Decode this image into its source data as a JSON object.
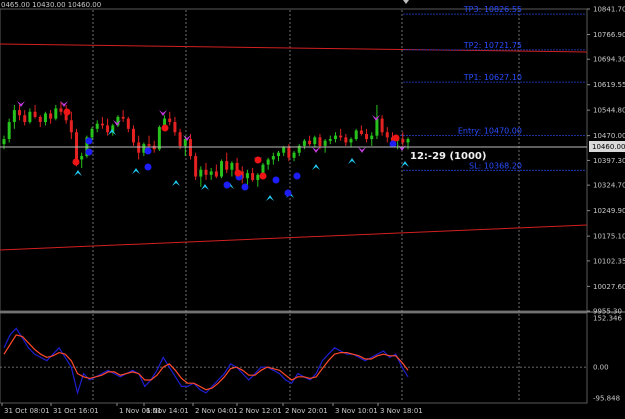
{
  "header": {
    "ohlc_text": "0465.00 10430.00 10460.00"
  },
  "levels": [
    {
      "key": "tp3",
      "label": "TP3: 10826.55",
      "value": 10826.55
    },
    {
      "key": "tp2",
      "label": "TP2: 10721.75",
      "value": 10721.75
    },
    {
      "key": "tp1",
      "label": "TP1: 10627.10",
      "value": 10627.1
    },
    {
      "key": "entry",
      "label": "Entry: 10470.00",
      "value": 10470.0
    },
    {
      "key": "sl",
      "label": "SL: 10368.20",
      "value": 10368.2
    }
  ],
  "trade_label": "12:-29 (1000)",
  "current_price": "10460.00",
  "price_axis": [
    "10841.70",
    "10766.90",
    "10694.30",
    "10619.55",
    "10544.80",
    "10470.00",
    "10397.30",
    "10324.70",
    "10249.90",
    "10175.10",
    "10102.35",
    "10027.60",
    "9955.30"
  ],
  "indicator_axis": [
    "152.346",
    "0.00",
    "-95.848"
  ],
  "time_axis": [
    "31 Oct 08:01",
    "31 Oct 16:01",
    "1 Nov 06:01",
    "1 Nov 14:01",
    "2 Nov 04:01",
    "2 Nov 12:01",
    "2 Nov 20:01",
    "3 Nov 10:01",
    "3 Nov 18:01"
  ],
  "colors": {
    "bull": "#27c21c",
    "bear": "#e52222",
    "grid": "#8a8a8a",
    "channel": "#d22020",
    "level": "#1f3fd0",
    "signal_blue": "#1d1df5",
    "signal_red": "#f01515",
    "arrow_purple": "#c53be0",
    "arrow_cyan": "#20c8f0",
    "osc_main": "#1f1fcf",
    "osc_signal": "#ff4a2a"
  },
  "chart_data": {
    "type": "candlestick",
    "price_range": [
      9955.3,
      10841.7
    ],
    "candles_ohlc": [
      [
        10445,
        10470,
        10430,
        10460
      ],
      [
        10460,
        10520,
        10450,
        10510
      ],
      [
        10510,
        10560,
        10490,
        10545
      ],
      [
        10545,
        10560,
        10515,
        10530
      ],
      [
        10530,
        10545,
        10500,
        10510
      ],
      [
        10510,
        10550,
        10505,
        10540
      ],
      [
        10540,
        10560,
        10520,
        10525
      ],
      [
        10525,
        10530,
        10495,
        10510
      ],
      [
        10510,
        10540,
        10500,
        10535
      ],
      [
        10535,
        10545,
        10505,
        10520
      ],
      [
        10520,
        10560,
        10515,
        10550
      ],
      [
        10550,
        10570,
        10530,
        10540
      ],
      [
        10540,
        10560,
        10505,
        10515
      ],
      [
        10515,
        10540,
        10460,
        10480
      ],
      [
        10480,
        10490,
        10380,
        10400
      ],
      [
        10400,
        10420,
        10375,
        10410
      ],
      [
        10410,
        10470,
        10405,
        10465
      ],
      [
        10465,
        10495,
        10455,
        10490
      ],
      [
        10490,
        10515,
        10480,
        10505
      ],
      [
        10505,
        10525,
        10490,
        10500
      ],
      [
        10500,
        10520,
        10470,
        10480
      ],
      [
        10480,
        10505,
        10470,
        10500
      ],
      [
        10500,
        10530,
        10495,
        10525
      ],
      [
        10525,
        10545,
        10510,
        10520
      ],
      [
        10520,
        10525,
        10480,
        10490
      ],
      [
        10490,
        10500,
        10440,
        10450
      ],
      [
        10450,
        10470,
        10400,
        10420
      ],
      [
        10420,
        10450,
        10410,
        10445
      ],
      [
        10445,
        10470,
        10435,
        10440
      ],
      [
        10440,
        10455,
        10420,
        10430
      ],
      [
        10430,
        10500,
        10425,
        10495
      ],
      [
        10495,
        10530,
        10485,
        10520
      ],
      [
        10520,
        10540,
        10500,
        10510
      ],
      [
        10510,
        10525,
        10470,
        10480
      ],
      [
        10480,
        10490,
        10430,
        10440
      ],
      [
        10440,
        10470,
        10410,
        10460
      ],
      [
        10460,
        10475,
        10400,
        10410
      ],
      [
        10410,
        10420,
        10340,
        10350
      ],
      [
        10350,
        10380,
        10320,
        10370
      ],
      [
        10370,
        10390,
        10340,
        10355
      ],
      [
        10355,
        10375,
        10340,
        10365
      ],
      [
        10365,
        10385,
        10345,
        10350
      ],
      [
        10350,
        10400,
        10345,
        10395
      ],
      [
        10395,
        10420,
        10360,
        10370
      ],
      [
        10370,
        10395,
        10350,
        10390
      ],
      [
        10390,
        10405,
        10360,
        10365
      ],
      [
        10365,
        10380,
        10330,
        10345
      ],
      [
        10345,
        10370,
        10325,
        10360
      ],
      [
        10360,
        10375,
        10335,
        10340
      ],
      [
        10340,
        10360,
        10320,
        10355
      ],
      [
        10355,
        10390,
        10350,
        10385
      ],
      [
        10385,
        10405,
        10370,
        10400
      ],
      [
        10400,
        10420,
        10385,
        10410
      ],
      [
        10410,
        10425,
        10395,
        10420
      ],
      [
        10420,
        10440,
        10410,
        10435
      ],
      [
        10435,
        10445,
        10395,
        10405
      ],
      [
        10405,
        10425,
        10395,
        10420
      ],
      [
        10420,
        10445,
        10410,
        10440
      ],
      [
        10440,
        10460,
        10430,
        10455
      ],
      [
        10455,
        10470,
        10440,
        10445
      ],
      [
        10445,
        10470,
        10435,
        10465
      ],
      [
        10465,
        10475,
        10430,
        10440
      ],
      [
        10440,
        10460,
        10420,
        10455
      ],
      [
        10455,
        10470,
        10445,
        10460
      ],
      [
        10460,
        10480,
        10450,
        10470
      ],
      [
        10470,
        10490,
        10455,
        10465
      ],
      [
        10465,
        10475,
        10440,
        10450
      ],
      [
        10450,
        10465,
        10435,
        10460
      ],
      [
        10460,
        10490,
        10455,
        10485
      ],
      [
        10485,
        10500,
        10470,
        10475
      ],
      [
        10475,
        10490,
        10450,
        10460
      ],
      [
        10460,
        10480,
        10440,
        10470
      ],
      [
        10470,
        10560,
        10460,
        10520
      ],
      [
        10520,
        10530,
        10470,
        10480
      ],
      [
        10480,
        10495,
        10450,
        10465
      ],
      [
        10465,
        10480,
        10440,
        10455
      ],
      [
        10455,
        10470,
        10430,
        10460
      ],
      [
        10460,
        10480,
        10440,
        10450
      ],
      [
        10450,
        10465,
        10430,
        10460
      ]
    ],
    "osc_main": [
      60,
      100,
      120,
      90,
      60,
      40,
      30,
      20,
      40,
      60,
      30,
      0,
      -80,
      -20,
      -40,
      -30,
      -20,
      -10,
      -20,
      -30,
      -20,
      -10,
      -20,
      -60,
      -40,
      -10,
      30,
      0,
      -30,
      -60,
      -60,
      -50,
      -70,
      -80,
      -60,
      -40,
      -20,
      10,
      0,
      -20,
      -40,
      -20,
      0,
      0,
      -10,
      -20,
      -40,
      -50,
      -20,
      -30,
      -40,
      -20,
      20,
      40,
      60,
      50,
      40,
      40,
      30,
      20,
      30,
      40,
      50,
      30,
      40,
      0,
      -30
    ],
    "osc_signal": [
      40,
      70,
      100,
      95,
      75,
      55,
      40,
      30,
      35,
      45,
      40,
      20,
      -20,
      -30,
      -35,
      -30,
      -25,
      -15,
      -15,
      -25,
      -20,
      -15,
      -20,
      -40,
      -40,
      -25,
      0,
      10,
      -10,
      -35,
      -50,
      -50,
      -60,
      -70,
      -65,
      -50,
      -30,
      -5,
      0,
      -10,
      -25,
      -25,
      -10,
      0,
      -5,
      -10,
      -25,
      -40,
      -30,
      -30,
      -35,
      -30,
      -5,
      20,
      40,
      45,
      45,
      40,
      35,
      25,
      25,
      35,
      40,
      35,
      35,
      15,
      -10
    ],
    "osc_range": [
      -95.848,
      152.346
    ]
  }
}
